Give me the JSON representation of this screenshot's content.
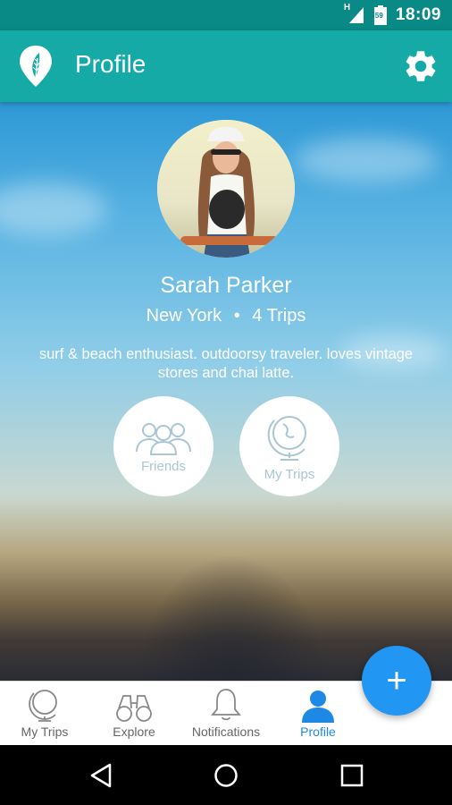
{
  "status_bar": {
    "network": "H",
    "time": "18:09",
    "battery_level": "59"
  },
  "app_bar": {
    "title": "Profile"
  },
  "profile": {
    "name": "Sarah Parker",
    "city": "New York",
    "separator": "•",
    "trips": "4 Trips",
    "bio": "surf & beach enthusiast. outdoorsy traveler. loves vintage stores and chai latte."
  },
  "actions": {
    "friends_label": "Friends",
    "my_trips_label": "My Trips"
  },
  "bottom_nav": {
    "items": [
      {
        "label": "My Trips",
        "icon": "globe-icon"
      },
      {
        "label": "Explore",
        "icon": "binoculars-icon"
      },
      {
        "label": "Notifications",
        "icon": "bell-icon"
      },
      {
        "label": "Profile",
        "icon": "person-icon",
        "active": true
      }
    ]
  },
  "fab": {
    "label": "+"
  },
  "colors": {
    "status_bar": "#0a8a86",
    "app_bar": "#15aaa5",
    "accent": "#2196f3"
  }
}
